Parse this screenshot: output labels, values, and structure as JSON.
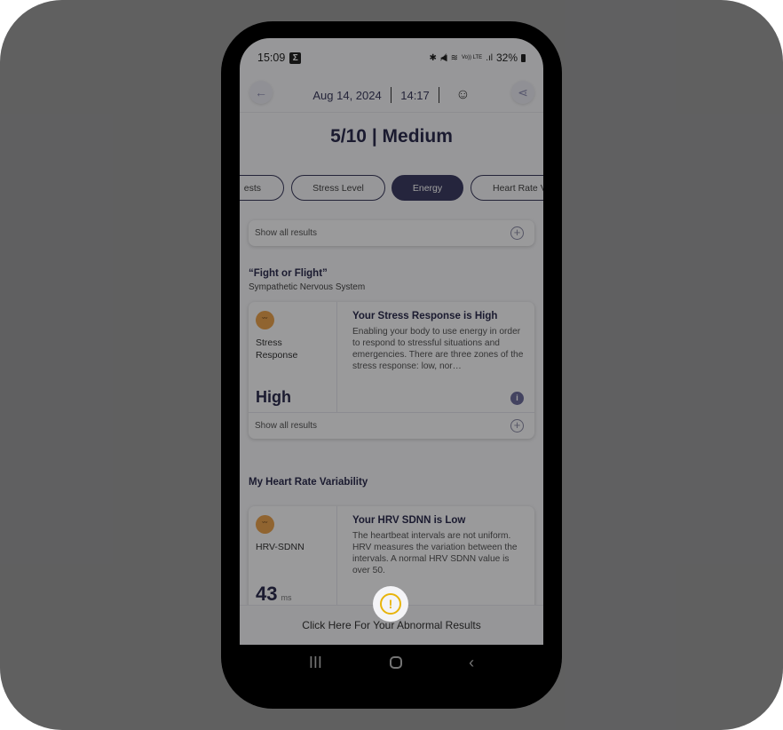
{
  "status_bar": {
    "time": "15:09",
    "notification_icon": "sigma-icon",
    "indicators": [
      "bluetooth-icon",
      "mute-icon",
      "wifi-icon",
      "volte-icon",
      "signal-icon"
    ],
    "volte_label": "Vo)) LTE",
    "battery": "32%"
  },
  "header": {
    "date": "Aug 14, 2024",
    "time": "14:17",
    "back_icon": "arrow-left-icon",
    "profile_icon": "face-icon",
    "share_icon": "share-icon"
  },
  "score": "5/10 | Medium",
  "tabs": [
    {
      "label": "ests",
      "active": false
    },
    {
      "label": "Stress Level",
      "active": false
    },
    {
      "label": "Energy",
      "active": true
    },
    {
      "label": "Heart Rate V",
      "active": false
    }
  ],
  "top_card": {
    "show_all_label": "Show all results"
  },
  "fight_flight": {
    "title": "“Fight or Flight”",
    "subtitle": "Sympathetic Nervous System",
    "metric": {
      "label": "Stress Response",
      "value": "High",
      "heading": "Your Stress Response is High",
      "description": "Enabling your body to use energy in order to respond to stressful situations and emergencies. There are three zones of the stress response: low, nor…",
      "status_color": "#e8a24e"
    },
    "show_all_label": "Show all results"
  },
  "hrv": {
    "title": "My Heart Rate Variability",
    "metric": {
      "label": "HRV-SDNN",
      "value": "43",
      "unit": "ms",
      "heading": "Your HRV SDNN is Low",
      "description": "The heartbeat intervals are not uniform. HRV measures the variation between the intervals. A normal HRV SDNN value is over 50.",
      "status_color": "#e8a24e"
    }
  },
  "abnormal_button": {
    "label": "Click Here For Your Abnormal Results",
    "icon": "alert-icon",
    "accent": "#e8b40b"
  },
  "nav": {
    "recents": "III",
    "back": "‹"
  }
}
